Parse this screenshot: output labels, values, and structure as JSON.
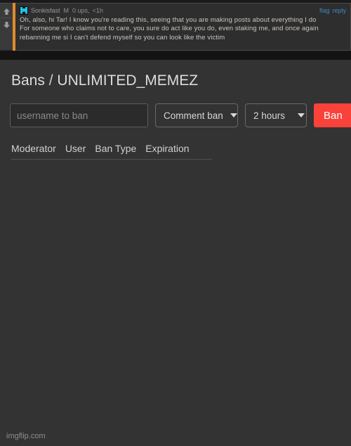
{
  "comment": {
    "username": "Sonkisfast",
    "mod_badge": "M",
    "points": "0 ups,",
    "age": "<1h",
    "flag_label": "flag",
    "reply_label": "reply",
    "body": "Oh, also, hi Tar! I know you're reading this, seeing that you are making posts about everything I do\nFor someone who claims not to care, you sure do act like you do, even staking me, and once again\nrebanning me si I can't defend myself so you can look like the victim",
    "accent_color": "#e08a2e",
    "link_color": "#3f87c4",
    "avatar_color": "#22c3e6"
  },
  "bans": {
    "title_prefix": "Bans",
    "title_separator": "/",
    "title_target": "UNLIMITED_MEMEZ",
    "form": {
      "username_placeholder": "username to ban",
      "username_value": "",
      "ban_type": "Comment ban",
      "duration": "2 hours",
      "submit_label": "Ban",
      "submit_color": "#f9423a"
    },
    "table": {
      "columns": [
        "Moderator",
        "User",
        "Ban Type",
        "Expiration"
      ],
      "rows": []
    }
  },
  "watermark": "imgflip.com"
}
